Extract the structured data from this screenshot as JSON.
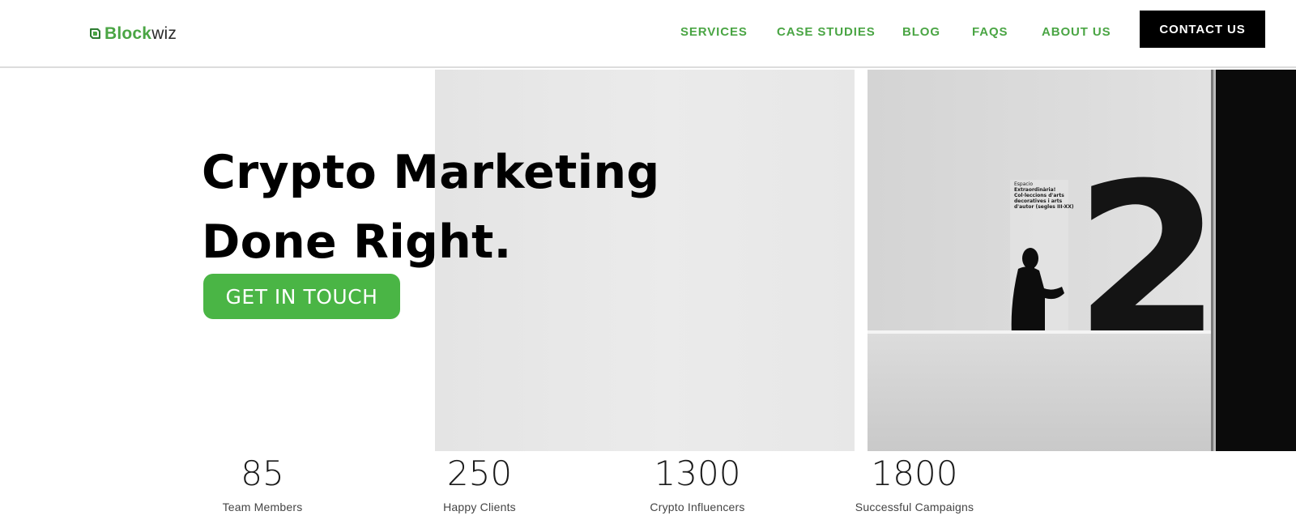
{
  "header": {
    "logo": {
      "text_part1": "Block",
      "text_part2": "wiz"
    },
    "nav": [
      "SERVICES",
      "CASE STUDIES",
      "BLOG",
      "FAQS",
      "ABOUT US"
    ],
    "contact_label": "CONTACT US"
  },
  "hero": {
    "title_line1": "Crypto Marketing",
    "title_line2": "Done Right.",
    "cta_label": "GET IN TOUCH",
    "photo": {
      "sign_line0": "Espacio",
      "sign_line1": "Extraordinària!",
      "sign_line2": "Col·leccions d'arts",
      "sign_line3": "decoratives i arts",
      "sign_line4": "d'autor (segles III-XX)",
      "big_numeral": "2"
    }
  },
  "stats": [
    {
      "value": "85",
      "label": "Team Members"
    },
    {
      "value": "250",
      "label": "Happy Clients"
    },
    {
      "value": "1300",
      "label": "Crypto Influencers"
    },
    {
      "value": "1800",
      "label": "Successful Campaigns"
    }
  ],
  "colors": {
    "brand_green": "#4aa544",
    "cta_green": "#4ab545",
    "contact_bg": "#000000",
    "text_dark": "#000000"
  },
  "icons": {
    "logo": "blockwiz-logo-icon"
  }
}
